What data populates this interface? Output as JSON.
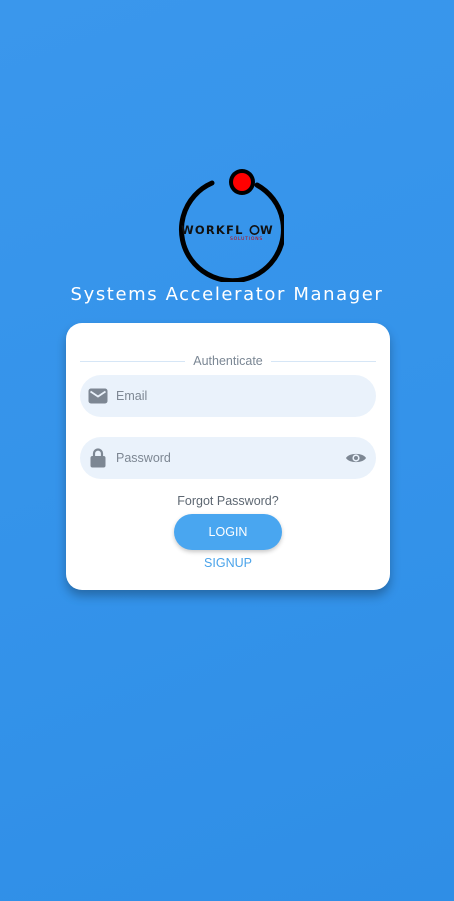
{
  "logo": {
    "text": "WORKFLOW",
    "subtext": "SOLUTIONS",
    "accent_color": "#ff0000"
  },
  "app_title": "Systems Accelerator Manager",
  "login_card": {
    "section_label": "Authenticate",
    "email": {
      "placeholder": "Email",
      "value": "",
      "icon": "email-icon"
    },
    "password": {
      "placeholder": "Password",
      "value": "",
      "icon": "lock-icon",
      "toggle_icon": "eye-icon"
    },
    "forgot_label": "Forgot Password?",
    "login_label": "LOGIN",
    "signup_label": "SIGNUP"
  },
  "colors": {
    "background": "#3493ea",
    "card": "#ffffff",
    "field_bg": "#eaf2fb",
    "button": "#49a6f0",
    "link": "#4aa3ea"
  }
}
